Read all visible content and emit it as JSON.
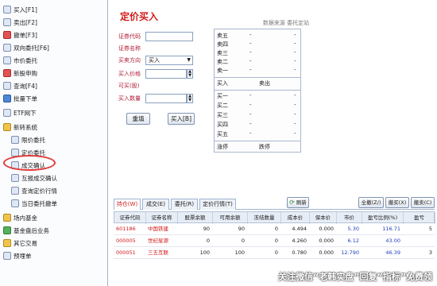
{
  "nav": {
    "items": [
      {
        "label": "买入[F1]",
        "icon": "doc"
      },
      {
        "label": "卖出[F2]",
        "icon": "doc"
      },
      {
        "label": "撤单[F3]",
        "icon": "red"
      },
      {
        "label": "双向委托[F6]",
        "icon": "doc"
      },
      {
        "label": "市价委托",
        "icon": "doc"
      },
      {
        "label": "新股申购",
        "icon": "red"
      },
      {
        "label": "查询[F4]",
        "icon": "doc"
      },
      {
        "label": "批量下单",
        "icon": "blu"
      },
      {
        "label": "ETF网下",
        "icon": "doc"
      },
      {
        "label": "新转系统",
        "icon": "fold"
      },
      {
        "label": "限价委托",
        "icon": "doc"
      },
      {
        "label": "定价委托",
        "icon": "doc"
      },
      {
        "label": "成交确认",
        "icon": "doc"
      },
      {
        "label": "互报成交确认",
        "icon": "doc"
      },
      {
        "label": "查询定价行情",
        "icon": "doc"
      },
      {
        "label": "当日委托撤单",
        "icon": "doc"
      },
      {
        "label": "场内基金",
        "icon": "fold"
      },
      {
        "label": "基金盘后业务",
        "icon": "grn"
      },
      {
        "label": "其它交易",
        "icon": "fold"
      },
      {
        "label": "预埋单",
        "icon": "doc"
      }
    ]
  },
  "title": "定价买入",
  "form": {
    "code_label": "证券代码",
    "name_label": "证券名称",
    "direction_label": "买卖方向",
    "direction_value": "买入",
    "price_label": "买入价格",
    "max_label": "可买(股)",
    "qty_label": "买入数量",
    "reset_button": "重填",
    "buy_button": "买入[B]"
  },
  "orderbook": {
    "header": "数据来源 委托定站",
    "sell_labels": [
      "卖五",
      "卖四",
      "卖三",
      "卖二",
      "卖一"
    ],
    "buy_labels": [
      "买一",
      "买二",
      "买三",
      "买四",
      "买五"
    ],
    "placeholder": "-",
    "mid_left": "买入",
    "mid_right": "卖出",
    "bottom_left": "涨停",
    "bottom_right": "跌停"
  },
  "tabs": [
    "持仓(W)",
    "成交(E)",
    "委托(R)",
    "定价行情(T)"
  ],
  "toolbar": {
    "refresh": "刷新",
    "select_all": "全撤(Z/)",
    "cancel_buy": "撤买(X)",
    "cancel_sell": "撤卖(C)"
  },
  "table": {
    "headers": [
      "证券代码",
      "证券名称",
      "股票余额",
      "可用余额",
      "冻结数量",
      "成本价",
      "保本价",
      "市价",
      "盈亏比例(%)",
      "盈亏"
    ],
    "rows": [
      [
        "601186",
        "中国铁建",
        "90",
        "90",
        "0",
        "4.494",
        "0.000",
        "5.30",
        "116.71",
        "5"
      ],
      [
        "000005",
        "世纪星源",
        "0",
        "0",
        "0",
        "4.260",
        "0.000",
        "6.12",
        "43.00",
        ""
      ],
      [
        "000051",
        "三五互联",
        "100",
        "100",
        "0",
        "0.780",
        "0.000",
        "12.790",
        "46.39",
        "3"
      ]
    ]
  },
  "watermark": "关注微信“老韩实盘”回复“指标”免费领"
}
